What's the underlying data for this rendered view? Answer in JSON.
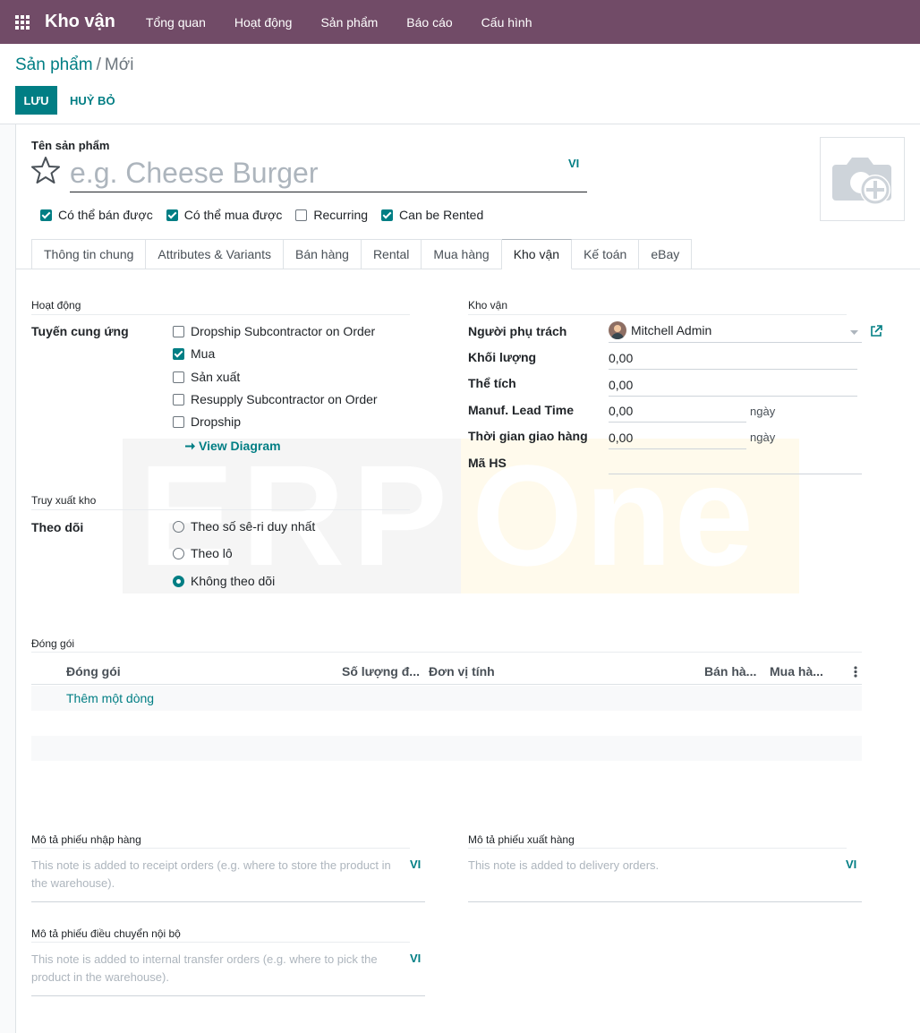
{
  "navbar": {
    "brand": "Kho vận",
    "menu": [
      "Tổng quan",
      "Hoạt động",
      "Sản phẩm",
      "Báo cáo",
      "Cấu hình"
    ]
  },
  "breadcrumb": {
    "parent": "Sản phẩm",
    "sep": "/",
    "current": "Mới"
  },
  "actions": {
    "save": "LƯU",
    "discard": "HUỶ BỎ"
  },
  "product": {
    "name_label": "Tên sản phẩm",
    "name_placeholder": "e.g. Cheese Burger",
    "lang": "VI",
    "checkboxes": [
      {
        "label": "Có thể bán được",
        "checked": true
      },
      {
        "label": "Có thể mua được",
        "checked": true
      },
      {
        "label": "Recurring",
        "checked": false
      },
      {
        "label": "Can be Rented",
        "checked": true
      }
    ]
  },
  "tabs": [
    "Thông tin chung",
    "Attributes & Variants",
    "Bán hàng",
    "Rental",
    "Mua hàng",
    "Kho vận",
    "Kế toán",
    "eBay"
  ],
  "operations": {
    "title": "Hoạt động",
    "routes_label": "Tuyến cung ứng",
    "routes": [
      {
        "label": "Dropship Subcontractor on Order",
        "checked": false
      },
      {
        "label": "Mua",
        "checked": true
      },
      {
        "label": "Sản xuất",
        "checked": false
      },
      {
        "label": "Resupply Subcontractor on Order",
        "checked": false
      },
      {
        "label": "Dropship",
        "checked": false
      }
    ],
    "view_diagram": "View Diagram"
  },
  "traceability": {
    "title": "Truy xuất kho",
    "tracking_label": "Theo dõi",
    "options": [
      {
        "label": "Theo số sê-ri duy nhất",
        "selected": false
      },
      {
        "label": "Theo lô",
        "selected": false
      },
      {
        "label": "Không theo dõi",
        "selected": true
      }
    ]
  },
  "logistics": {
    "title": "Kho vận",
    "responsible_label": "Người phụ trách",
    "responsible_value": "Mitchell Admin",
    "weight_label": "Khối lượng",
    "weight_value": "0,00",
    "volume_label": "Thể tích",
    "volume_value": "0,00",
    "manuf_label": "Manuf. Lead Time",
    "manuf_value": "0,00",
    "manuf_unit": "ngày",
    "delivery_label": "Thời gian giao hàng",
    "delivery_value": "0,00",
    "delivery_unit": "ngày",
    "hs_label": "Mã HS",
    "hs_value": ""
  },
  "watermark": {
    "left": "ERP",
    "right": "One"
  },
  "packaging": {
    "title": "Đóng gói",
    "columns": [
      "Đóng gói",
      "Số lượng đ...",
      "Đơn vị tính",
      "Bán hà...",
      "Mua hà..."
    ],
    "add_line": "Thêm một dòng"
  },
  "notes": {
    "receipt_title": "Mô tả phiếu nhập hàng",
    "receipt_placeholder": "This note is added to receipt orders (e.g. where to store the product in the warehouse).",
    "delivery_title": "Mô tả phiếu xuất hàng",
    "delivery_placeholder": "This note is added to delivery orders.",
    "internal_title": "Mô tả phiếu điều chuyển nội bộ",
    "internal_placeholder": "This note is added to internal transfer orders (e.g. where to pick the product in the warehouse).",
    "lang": "VI"
  },
  "colors": {
    "primary": "#714b67",
    "accent": "#017e84"
  }
}
